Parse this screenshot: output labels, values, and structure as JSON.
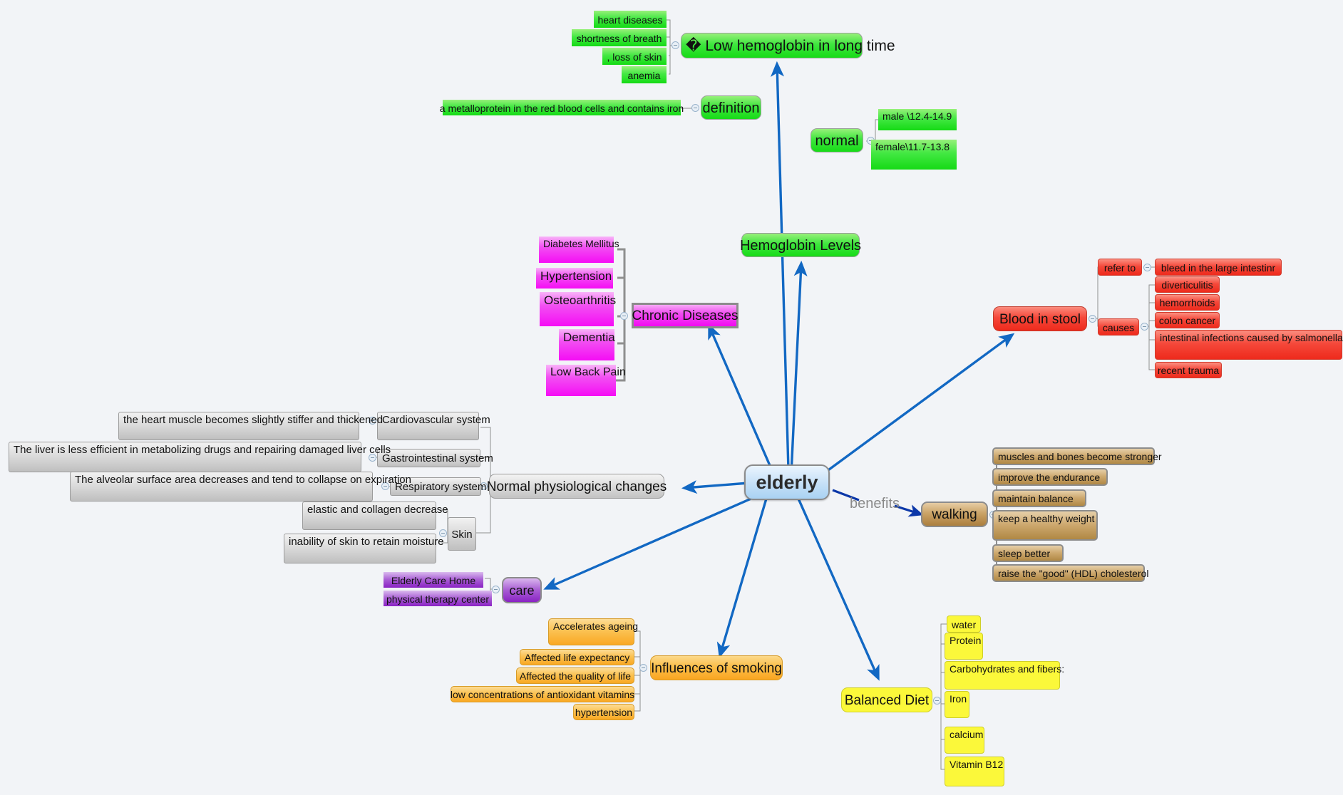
{
  "central": {
    "label": "elderly"
  },
  "edge_labels": {
    "benefits": "benefits"
  },
  "branches": {
    "hemoglobin": {
      "label": "Hemoglobin Levels",
      "color": "#2ee02e",
      "children": [
        {
          "label": "� Low hemoglobin in long time",
          "children": [
            {
              "label": "heart diseases"
            },
            {
              "label": "shortness of breath"
            },
            {
              "label": ", loss of skin"
            },
            {
              "label": "anemia"
            }
          ]
        },
        {
          "label": "definition",
          "children": [
            {
              "label": "a metalloprotein in the red blood cells and contains iron"
            }
          ]
        },
        {
          "label": "normal",
          "children": [
            {
              "label": "male \\12.4-14.9"
            },
            {
              "label": "female\\11.7-13.8"
            }
          ]
        }
      ]
    },
    "chronic": {
      "label": "Chronic Diseases",
      "color": "#f20cf2",
      "children": [
        {
          "label": "Diabetes Mellitus"
        },
        {
          "label": "Hypertension"
        },
        {
          "label": "Osteoarthritis"
        },
        {
          "label": "Dementia"
        },
        {
          "label": "Low Back Pain"
        }
      ]
    },
    "blood_in_stool": {
      "label": "Blood in stool",
      "color": "#ee2a1c",
      "children": [
        {
          "label": "refer to",
          "children": [
            {
              "label": "bleed in the large intestinr"
            }
          ]
        },
        {
          "label": "causes",
          "children": [
            {
              "label": "diverticulitis"
            },
            {
              "label": "hemorrhoids"
            },
            {
              "label": "colon cancer"
            },
            {
              "label": "intestinal infections caused by  salmonella"
            },
            {
              "label": "recent trauma"
            }
          ]
        }
      ]
    },
    "physiological": {
      "label": "Normal physiological changes",
      "color": "#c3c3c3",
      "children": [
        {
          "label": "Cardiovascular system",
          "children": [
            {
              "label": "the heart muscle becomes slightly stiffer and thickened"
            }
          ]
        },
        {
          "label": "Gastrointestinal system",
          "children": [
            {
              "label": "The liver is less efficient in metabolizing drugs and repairing damaged liver cells"
            }
          ]
        },
        {
          "label": "Respiratory system",
          "children": [
            {
              "label": "The alveolar surface area decreases and tend to collapse on expiration"
            }
          ]
        },
        {
          "label": "Skin",
          "children": [
            {
              "label": "elastic and collagen decrease"
            },
            {
              "label": "inability of skin to retain moisture"
            }
          ]
        }
      ]
    },
    "walking": {
      "label": "walking",
      "color": "#b08844",
      "children": [
        {
          "label": "muscles and bones become stronger"
        },
        {
          "label": "improve the endurance"
        },
        {
          "label": "maintain balance"
        },
        {
          "label": "keep a healthy weight"
        },
        {
          "label": "sleep better"
        },
        {
          "label": "raise the \"good\" (HDL) cholesterol"
        }
      ]
    },
    "care": {
      "label": "care",
      "color": "#8a23c4",
      "children": [
        {
          "label": "Elderly Care Home"
        },
        {
          "label": "physical therapy center"
        }
      ]
    },
    "smoking": {
      "label": "Influences of smoking",
      "color": "#f9a520",
      "children": [
        {
          "label": "Accelerates ageing"
        },
        {
          "label": "Affected life expectancy"
        },
        {
          "label": "Affected the quality of life"
        },
        {
          "label": "low concentrations of antioxidant vitamins"
        },
        {
          "label": "hypertension"
        }
      ]
    },
    "diet": {
      "label": "Balanced Diet",
      "color": "#fbf83a",
      "children": [
        {
          "label": "water"
        },
        {
          "label": "Protein"
        },
        {
          "label": "Carbohydrates and fibers:"
        },
        {
          "label": "Iron"
        },
        {
          "label": "calcium"
        },
        {
          "label": "Vitamin B12"
        }
      ]
    }
  }
}
